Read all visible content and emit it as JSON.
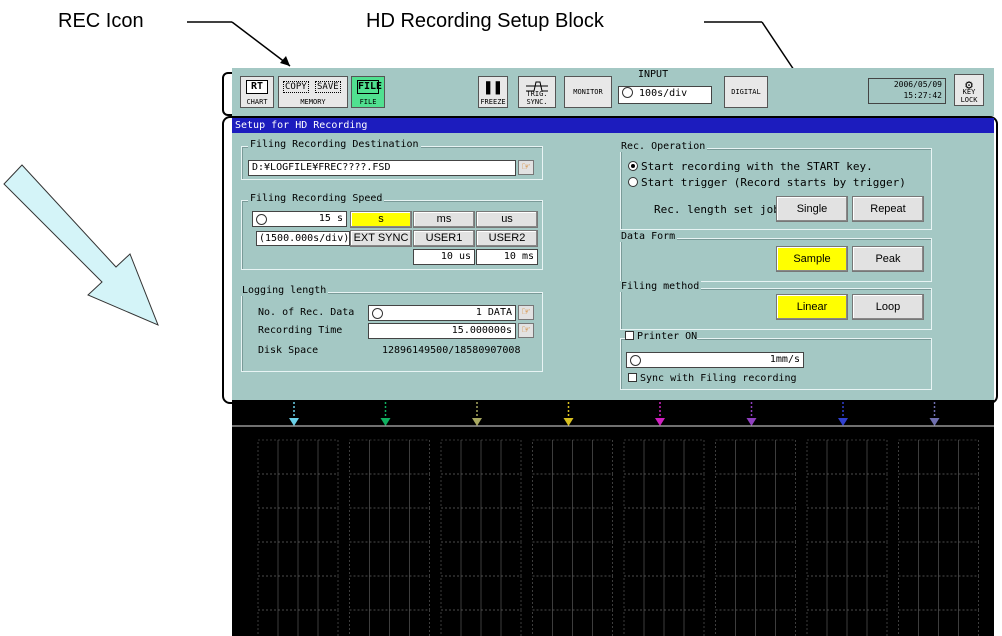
{
  "callouts": {
    "rec_icon": "REC Icon",
    "hd_block": "HD Recording Setup Block"
  },
  "toolbar": {
    "rt": "RT",
    "chart": "CHART",
    "copy": "COPY",
    "save": "SAVE",
    "memory": "MEMORY",
    "file_icon": "FILE",
    "file_label": "FILE",
    "freeze": "FREEZE",
    "trig_sync": "TRIG. SYNC.",
    "monitor": "MONITOR",
    "input_label": "INPUT",
    "input_value": "100s/div",
    "digital": "DIGITAL",
    "date": "2006/05/09",
    "time": "15:27:42",
    "keylock": "KEY LOCK"
  },
  "setup": {
    "title": "Setup for HD Recording",
    "dest": {
      "title": "Filing Recording Destination",
      "path": "D:¥LOGFILE¥FREC????.FSD"
    },
    "speed": {
      "title": "Filing Recording Speed",
      "value": "15 s",
      "per_div": "(1500.000s/div)",
      "units": [
        "s",
        "ms",
        "us"
      ],
      "ext_sync": "EXT SYNC",
      "user1": "USER1",
      "user2": "USER2",
      "user1_value": "10 us",
      "user2_value": "10 ms"
    },
    "logging": {
      "title": "Logging length",
      "rec_data_label": "No. of Rec. Data",
      "rec_data_value": "1 DATA",
      "rec_time_label": "Recording Time",
      "rec_time_value": "15.000000s",
      "disk_label": "Disk Space",
      "disk_value": "12896149500/18580907008"
    },
    "rec_op": {
      "title": "Rec. Operation",
      "opt1": "Start recording with the START key.",
      "opt2": "Start trigger (Record starts by trigger)",
      "len_label": "Rec. length set job",
      "single": "Single",
      "repeat": "Repeat"
    },
    "data_form": {
      "title": "Data Form",
      "sample": "Sample",
      "peak": "Peak"
    },
    "filing_method": {
      "title": "Filing method",
      "linear": "Linear",
      "loop": "Loop"
    },
    "printer": {
      "label": "Printer ON",
      "speed": "1mm/s",
      "sync": "Sync with Filing recording"
    }
  },
  "markers": {
    "colors": [
      "#6ad0e8",
      "#10b060",
      "#a8a860",
      "#d8c020",
      "#d020c0",
      "#9040c0",
      "#3040d0",
      "#7070b0"
    ]
  }
}
